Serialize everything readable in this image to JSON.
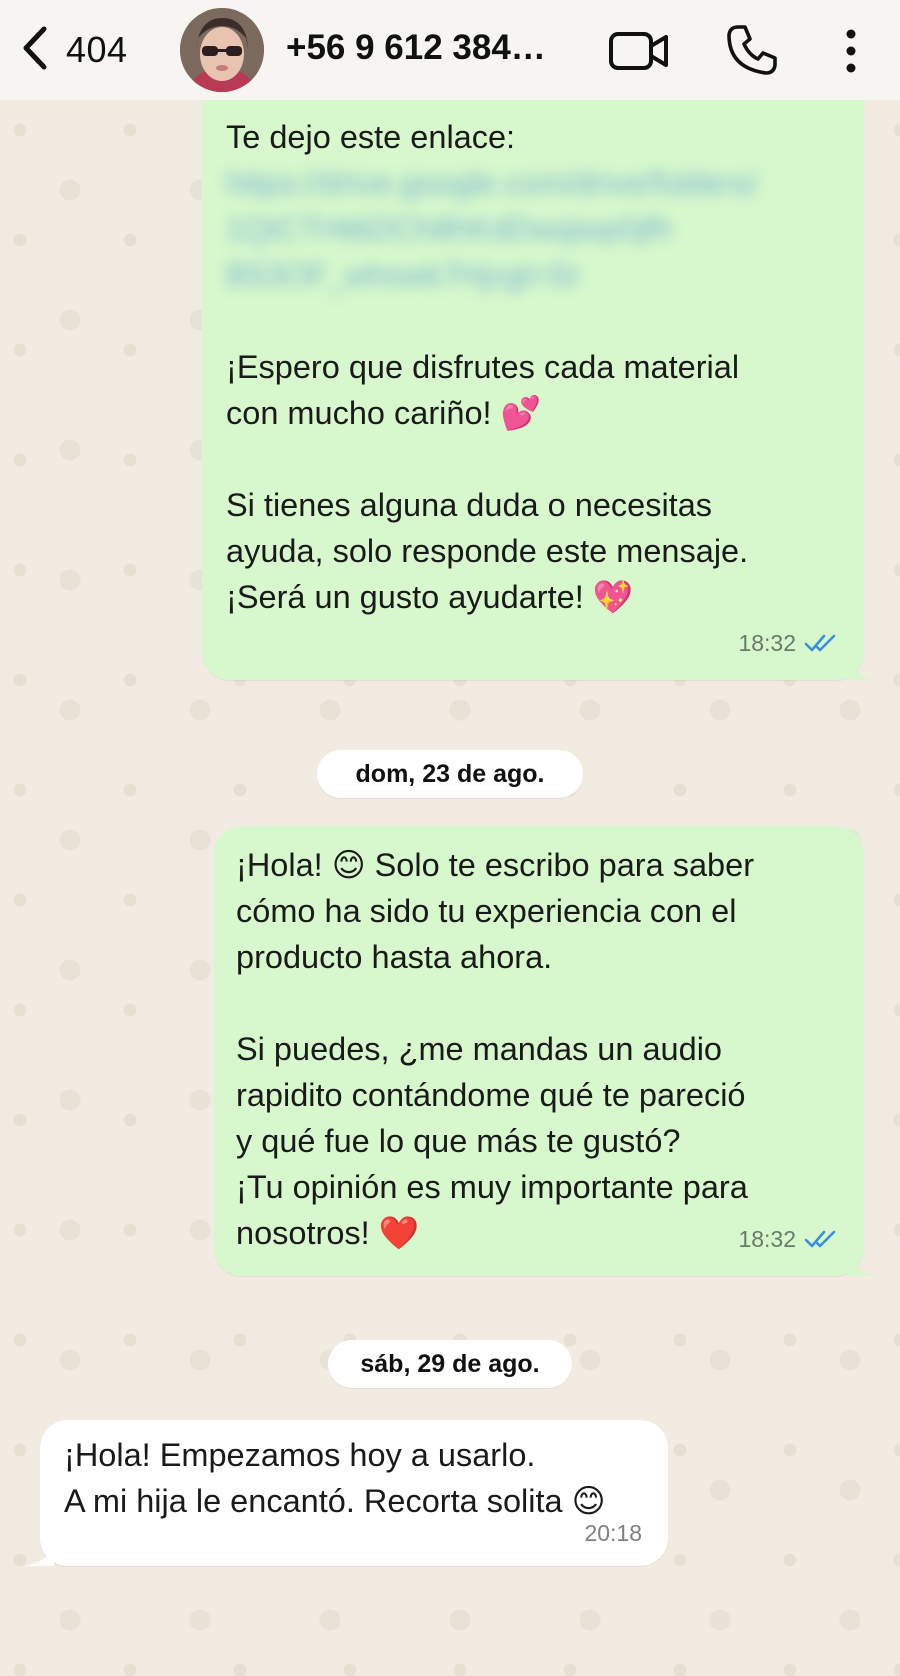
{
  "header": {
    "back_count": "404",
    "contact_name": "+56 9 612 384…"
  },
  "messages": [
    {
      "direction": "outgoing",
      "intro": "Te dejo este enlace:",
      "link_blurred": "https://drive.google.com/drive/folders/\n1QtCTHt6DCh8hKdDwqiwp0jfh\nB53OF_whswk7Hjcgl=Sr",
      "body": "¡Espero que disfrutes cada material\ncon mucho cariño! 💕\n\nSi tienes alguna duda o necesitas\nayuda, solo responde este mensaje.\n¡Será un gusto ayudarte! 💖",
      "time": "18:32",
      "status": "read"
    },
    {
      "direction": "outgoing",
      "body": "¡Hola! 😊  Solo te escribo para saber\ncómo ha sido tu experiencia con el\nproducto hasta ahora.\n\nSi puedes, ¿me mandas un audio\nrapidito contándome qué te pareció\ny qué fue lo que más te gustó?\n¡Tu opinión es muy importante para\nnosotros! ❤️",
      "time": "18:32",
      "status": "read"
    },
    {
      "direction": "incoming",
      "body": "¡Hola! Empezamos hoy a usarlo.\nA mi hija le encantó. Recorta solita 😊",
      "time": "20:18"
    }
  ],
  "date_separators": [
    "dom, 23 de ago.",
    "sáb, 29 de ago."
  ],
  "colors": {
    "outgoing_bubble": "#d6f8cc",
    "incoming_bubble": "#ffffff",
    "read_ticks": "#3b8fe0",
    "background": "#f1ebe1"
  },
  "icons": [
    "chevron-left-icon",
    "video-camera-icon",
    "phone-icon",
    "more-vertical-icon",
    "double-check-icon"
  ]
}
